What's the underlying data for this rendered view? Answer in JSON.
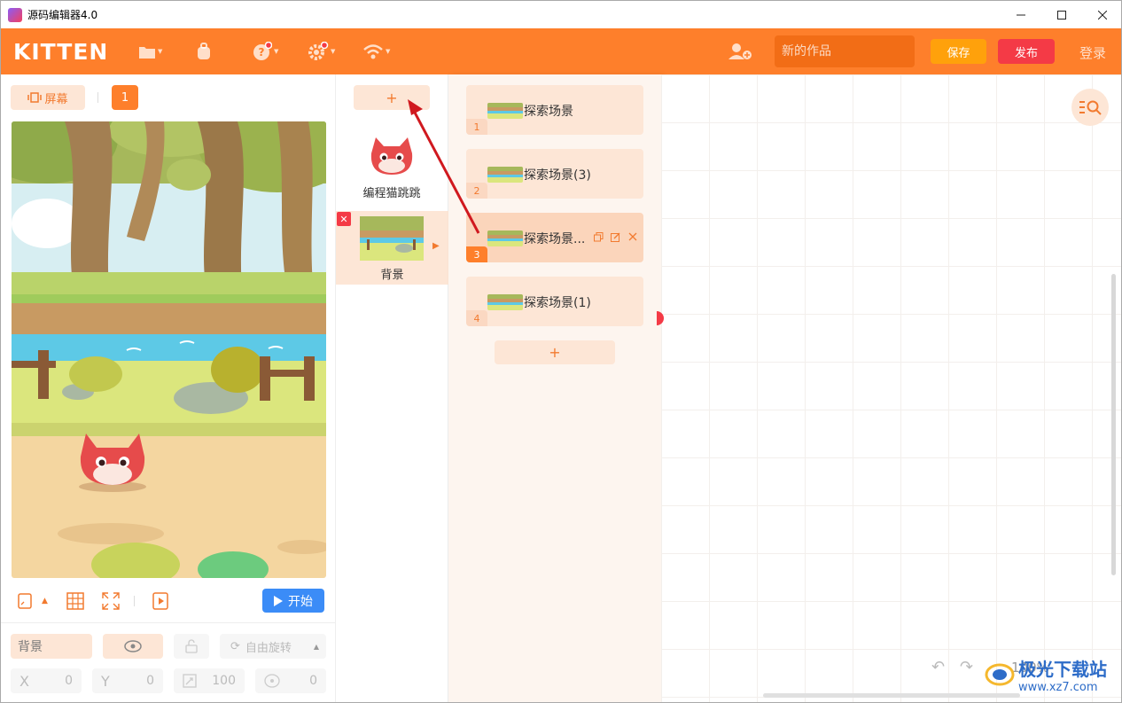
{
  "window": {
    "title": "源码编辑器4.0"
  },
  "header": {
    "logo": "KITTEN",
    "project_placeholder": "新的作品",
    "save_label": "保存",
    "publish_label": "发布",
    "login_label": "登录"
  },
  "stage": {
    "screen_button": "屏幕",
    "screen_number": "1",
    "start_button": "开始"
  },
  "properties": {
    "name_value": "背景",
    "rotation_mode": "自由旋转",
    "x_label": "X",
    "x_value": "0",
    "y_label": "Y",
    "y_value": "0",
    "size_value": "100",
    "direction_value": "0"
  },
  "sprites": {
    "add_label": "+",
    "items": [
      {
        "label": "编程猫跳跳"
      },
      {
        "label": "背景"
      }
    ]
  },
  "scenes": {
    "items": [
      {
        "num": "1",
        "name": "探索场景"
      },
      {
        "num": "2",
        "name": "探索场景(3)"
      },
      {
        "num": "3",
        "name": "探索场景..."
      },
      {
        "num": "4",
        "name": "探索场景(1)"
      }
    ],
    "add_label": "+"
  },
  "workspace": {
    "zoom": "100%"
  },
  "watermark": {
    "text": "极光下载站",
    "url": "www.xz7.com"
  },
  "colors": {
    "brand": "#fe7f2b",
    "save": "#ffa10b",
    "publish": "#f43a46",
    "start": "#3b8cf7",
    "annotation_arrow": "#d0191f"
  }
}
